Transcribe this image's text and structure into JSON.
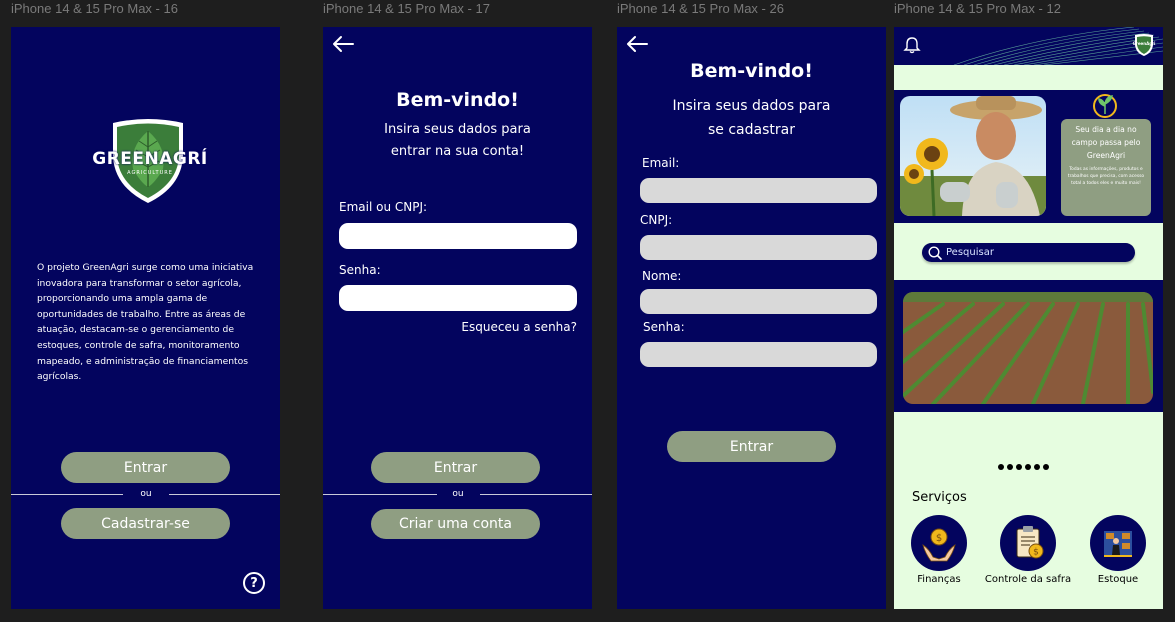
{
  "frames": {
    "f1": {
      "label": "iPhone 14 & 15 Pro Max - 16",
      "logo_text": "GREENAGRÍ",
      "logo_sub": "AGRICULTURE",
      "about": "O projeto GreenAgri surge como uma iniciativa inovadora para transformar o setor agrícola, proporcionando uma ampla gama de oportunidades de trabalho. Entre as áreas de atuação, destacam-se o gerenciamento de estoques, controle de safra, monitoramento mapeado, e administração de financiamentos agrícolas.",
      "login_button": "Entrar",
      "or_text": "ou",
      "register_button": "Cadastrar-se",
      "help_icon": "question-circle-icon",
      "help_glyph": "?"
    },
    "f2": {
      "label": "iPhone 14 & 15 Pro Max - 17",
      "title": "Bem-vindo!",
      "subtitle_line1": "Insira seus dados para",
      "subtitle_line2": "entrar na sua conta!",
      "email_label": "Email ou CNPJ:",
      "email_value": "",
      "password_label": "Senha:",
      "password_value": "",
      "forgot": "Esqueceu a senha?",
      "login_button": "Entrar",
      "or_text": "ou",
      "create_button": "Criar uma conta"
    },
    "f3": {
      "label": "iPhone 14 & 15 Pro Max - 26",
      "title": "Bem-vindo!",
      "subtitle_line1": "Insira seus dados para",
      "subtitle_line2": "se cadastrar",
      "email_label": "Email:",
      "cnpj_label": "CNPJ:",
      "name_label": "Nome:",
      "password_label": "Senha:",
      "submit_button": "Entrar"
    },
    "f4": {
      "label": "iPhone 14 & 15 Pro Max - 12",
      "bell_icon": "bell-icon",
      "logo_text": "GreenAgri",
      "info_title": "Seu dia a dia no campo passa pelo GreenAgri",
      "info_body": "Todas as informações, produtos e trabalhos que precisa, com acesso total a todos eles e muito mais!",
      "search_placeholder": "Pesquisar",
      "services_title": "Serviços",
      "services": [
        {
          "label": "Finanças",
          "icon": "money-hands-icon"
        },
        {
          "label": "Controle da safra",
          "icon": "clipboard-coin-icon"
        },
        {
          "label": "Estoque",
          "icon": "warehouse-worker-icon"
        }
      ]
    }
  },
  "colors": {
    "navy": "#03045e",
    "sage": "#8f9e82",
    "mint": "#e6fde0",
    "input_gray": "#d9d9d9"
  }
}
